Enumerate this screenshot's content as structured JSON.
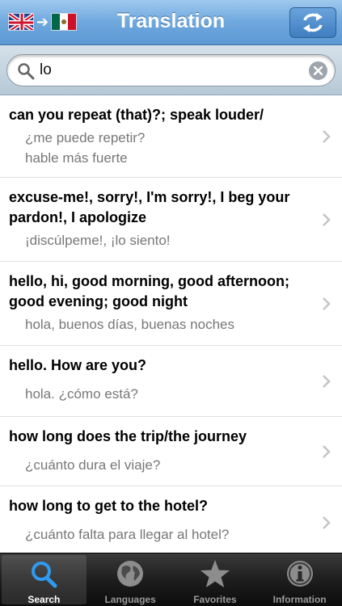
{
  "navbar": {
    "title": "Translation",
    "source_flag": "uk-flag-icon",
    "target_flag": "mexico-flag-icon",
    "swap_icon": "swap-arrows-icon"
  },
  "search": {
    "value": "lo",
    "icon": "search-icon",
    "clear_icon": "clear-icon"
  },
  "results": [
    {
      "en": "can you repeat (that)?; speak louder/",
      "es": "¿me puede repetir? hable más fuerte"
    },
    {
      "en": "excuse-me!, sorry!, I'm sorry!, I beg your pardon!, I apologize",
      "es": "¡discúlpeme!, ¡lo siento!"
    },
    {
      "en": "hello, hi, good morning, good afternoon; good evening; good night",
      "es": "hola, buenos días, buenas noches"
    },
    {
      "en": "hello. How are you?",
      "es": "hola. ¿cómo está?"
    },
    {
      "en": "how long does the trip/the journey",
      "es": "¿cuánto dura el viaje?"
    },
    {
      "en": "how long to get to the hotel?",
      "es": "¿cuánto falta para llegar al hotel?"
    }
  ],
  "tabs": [
    {
      "label": "Search",
      "icon": "search-icon",
      "active": true
    },
    {
      "label": "Languages",
      "icon": "globe-icon",
      "active": false
    },
    {
      "label": "Favorites",
      "icon": "star-icon",
      "active": false
    },
    {
      "label": "Information",
      "icon": "info-icon",
      "active": false
    }
  ],
  "colors": {
    "navbar": "#6fa8de",
    "active_tab_icon": "#2f9bf0",
    "secondary_text": "#777777"
  }
}
